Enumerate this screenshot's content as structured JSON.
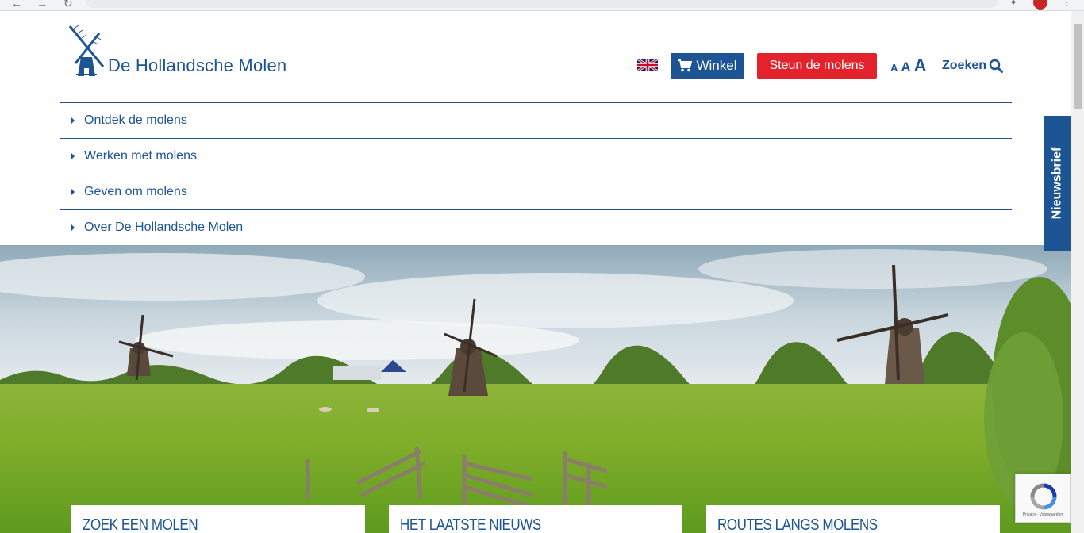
{
  "site": {
    "logo_text": "De Hollandsche Molen"
  },
  "header": {
    "winkel_label": "Winkel",
    "steun_label": "Steun de molens",
    "font_small": "A",
    "font_medium": "A",
    "font_large": "A",
    "search_label": "Zoeken"
  },
  "menu": {
    "items": [
      {
        "label": "Ontdek de molens"
      },
      {
        "label": "Werken met molens"
      },
      {
        "label": "Geven om molens"
      },
      {
        "label": "Over De Hollandsche Molen"
      }
    ]
  },
  "newsletter": {
    "label": "Nieuwsbrief"
  },
  "cards": [
    {
      "title": "Zoek een molen"
    },
    {
      "title": "Het laatste nieuws"
    },
    {
      "title": "Routes langs molens"
    }
  ],
  "recaptcha": {
    "text": "Privacy - Voorwaarden"
  },
  "colors": {
    "brand_blue": "#1d5494",
    "accent_red": "#e4222b"
  },
  "icons": {
    "cart": "cart-icon",
    "search": "search-icon",
    "flag": "uk-flag-icon",
    "logo": "windmill-logo-icon"
  }
}
